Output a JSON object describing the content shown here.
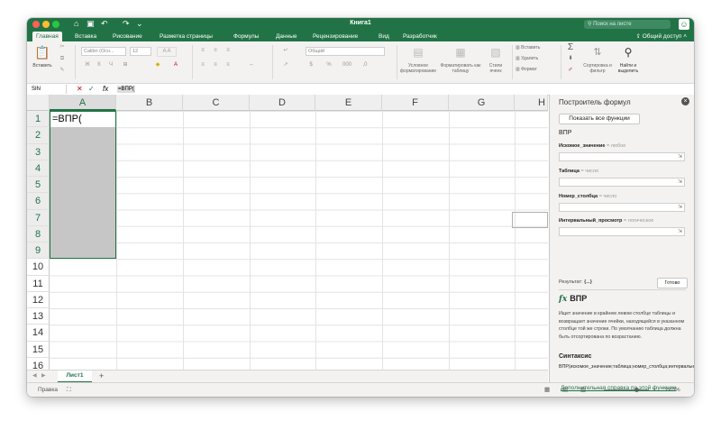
{
  "titlebar": {
    "title": "Книга1",
    "search_placeholder": "Поиск на листе"
  },
  "ribbon_tabs": [
    {
      "label": "Главная",
      "active": true
    },
    {
      "label": "Вставка"
    },
    {
      "label": "Рисование"
    },
    {
      "label": "Разметка страницы"
    },
    {
      "label": "Формулы"
    },
    {
      "label": "Данные"
    },
    {
      "label": "Рецензирование"
    },
    {
      "label": "Вид"
    },
    {
      "label": "Разработчик"
    }
  ],
  "share_label": "Общий доступ",
  "ribbon": {
    "paste": "Вставить",
    "font_name": "Calibri (Осн...",
    "font_size": "12",
    "number_format": "Общий",
    "conditional_formatting": "Условное форматирование",
    "format_as_table": "Форматировать как таблицу",
    "cell_styles": "Стили ячеек",
    "insert": "Вставить",
    "delete": "Удалить",
    "format": "Формат",
    "sort_filter": "Сортировка и фильтр",
    "find_select": "Найти и выделить"
  },
  "formula_bar": {
    "name_box": "SIN",
    "formula": "=ВПР("
  },
  "columns": [
    "A",
    "B",
    "C",
    "D",
    "E",
    "F",
    "G",
    "H"
  ],
  "rows": [
    "1",
    "2",
    "3",
    "4",
    "5",
    "6",
    "7",
    "8",
    "9",
    "10",
    "11",
    "12",
    "13",
    "14",
    "15",
    "16"
  ],
  "active_cell_value": "=ВПР(",
  "sheet_tab": "Лист1",
  "status": {
    "ready": "Правка",
    "zoom": "210%"
  },
  "pane": {
    "title": "Построитель формул",
    "show_all": "Показать все функции",
    "function_name": "ВПР",
    "args": [
      {
        "label": "Искомое_значение",
        "eq": "=",
        "type": "любое"
      },
      {
        "label": "Таблица",
        "eq": "=",
        "type": "число"
      },
      {
        "label": "Номер_столбца",
        "eq": "=",
        "type": "число"
      },
      {
        "label": "Интервальный_просмотр",
        "eq": "=",
        "type": "логическое"
      }
    ],
    "result_label": "Результат:",
    "result_value": "{...}",
    "done": "Готово",
    "fx_name": "ВПР",
    "description": "Ищет значение в крайнем левом столбце таблицы и возвращает значение ячейки, находящейся в указанном столбце той же строки. По умолчанию таблица должна быть отсортирована по возрастанию.",
    "syntax_heading": "Синтаксис",
    "syntax": "ВПР(искомое_значение;таблица;номер_столбца;интервальный_просмотр)",
    "help_link": "Дополнительная справка по этой функции"
  }
}
